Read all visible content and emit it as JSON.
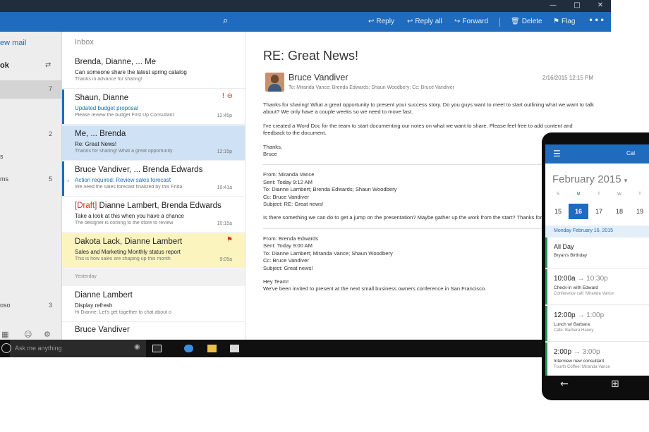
{
  "window": {
    "title_buttons": [
      "—",
      "□",
      "✕"
    ]
  },
  "toolbar": {
    "actions": [
      {
        "icon": "reply-icon",
        "glyph": "↩",
        "label": "Reply"
      },
      {
        "icon": "reply-all-icon",
        "glyph": "↩",
        "label": "Reply all"
      },
      {
        "icon": "forward-icon",
        "glyph": "↪",
        "label": "Forward"
      },
      {
        "icon": "delete-icon",
        "glyph": "🗑",
        "label": "Delete"
      },
      {
        "icon": "flag-icon",
        "glyph": "⚑",
        "label": "Flag"
      }
    ],
    "more": "•••",
    "accent": "#1f6bbd"
  },
  "nav": {
    "new_mail": "ew mail",
    "account": "ok",
    "rows": [
      {
        "label": "",
        "count": "7"
      },
      {
        "label": "",
        "count": ""
      },
      {
        "label": "",
        "count": "2"
      },
      {
        "label": "s",
        "count": ""
      },
      {
        "label": "ms",
        "count": "5"
      }
    ],
    "folder_bottom": {
      "label": "oso",
      "count": "3"
    }
  },
  "list": {
    "header": "Inbox",
    "messages": [
      {
        "from": "Brenda, Dianne, ... Me",
        "subject": "Can someone share the latest spring catalog",
        "preview": "Thanks in advance for sharing!",
        "time": ""
      },
      {
        "from": "Shaun, Dianne",
        "subject": "Updated budget proposal",
        "preview": "Please review the budget First Up Consultant",
        "time": "12:45p"
      },
      {
        "from": "Me, ... Brenda",
        "subject": "Re: Great News!",
        "preview": "Thanks for sharing! What a great opportunity",
        "time": "12:15p"
      },
      {
        "from": "Bruce Vandiver, ... Brenda Edwards",
        "subject": "Action required: Review sales forecast",
        "preview": "We need the sales forecast finalized by this Frida",
        "time": "10:41a"
      },
      {
        "draft": "[Draft]",
        "from": "Dianne Lambert, Brenda Edwards",
        "subject": "Take a look at this when you have a chance",
        "preview": "The designer is coming to the store to review",
        "time": "10:15a"
      },
      {
        "from": "Dakota Lack, Dianne Lambert",
        "subject": "Sales and Marketing Monthly status report",
        "preview": "This is how sales are shaping up this month",
        "time": "9:05a"
      }
    ],
    "divider": "Yesterday",
    "older": [
      {
        "from": "Dianne Lambert",
        "subject": "Display refresh",
        "preview": "Hi Dianne. Let's get together to chat about o",
        "time": ""
      },
      {
        "from": "Bruce Vandiver",
        "subject": "",
        "preview": "",
        "time": ""
      }
    ]
  },
  "reading": {
    "subject": "RE: Great News!",
    "sender": "Bruce Vandiver",
    "to": "To: Miranda Vance; Brenda Edwards; Shaun Woodbery;  Cc: Bruce Vandiver",
    "date": "2/16/2015  12:15 PM",
    "body": [
      "Thanks for sharing! What a great opportunity to present your success story. Do you guys want to meet to start outlining what we want to talk about? We only have a couple weeks so we need to move fast.",
      "I've created a Word Doc for the team to start documenting our notes on what we want to share. Please feel free to add content and feedback to the document.",
      "Thanks,",
      "Bruce"
    ],
    "quote1": {
      "header": [
        "From: Miranda Vance",
        "Sent: Today 9:12 AM",
        "To: Dianne Lambert; Brenda Edwards; Shaun Woodbery",
        "Cc: Bruce Vandiver",
        "Subject: RE: Great news!"
      ],
      "text": "Is there something we can do to get a jump on the presentation? Maybe gather up the work from the start? Thanks for sharing Brenda."
    },
    "quote2": {
      "header": [
        "From: Brenda Edwards",
        "Sent: Today 9:00 AM",
        "To: Dianne Lambert; Miranda Vance; Shaun Woodbery",
        "Cc: Bruce Vandiver",
        "Subject: Great news!"
      ],
      "greeting": "Hey Team!",
      "text": "We've been invited to present at the next small business owners conference in San Francisco."
    }
  },
  "taskbar": {
    "search_placeholder": "Ask me anything",
    "icons": [
      "task-view-icon",
      "edge-icon",
      "file-explorer-icon",
      "store-icon"
    ]
  },
  "phone": {
    "top_tab": "Cal",
    "month": "February 2015",
    "week_days": [
      "S",
      "M",
      "T",
      "W",
      "T"
    ],
    "week_dates": [
      "15",
      "16",
      "17",
      "18",
      "19"
    ],
    "selected_date": "16",
    "day_header": "Monday February 16, 2015",
    "all_day": {
      "label": "All Day",
      "title": "Bryan's Birthday"
    },
    "events": [
      {
        "start": "10:00a",
        "end": "→ 10:30p",
        "title": "Check-in with Edward",
        "location": "Conference call: Miranda Vance"
      },
      {
        "start": "12:00p",
        "end": "→ 1:00p",
        "title": "Lunch w/ Barbara",
        "location": "Cafe: Barbara Haney"
      },
      {
        "start": "2:00p",
        "end": "→ 3:00p",
        "title": "Interview new consultant",
        "location": "Fourth Coffee: Miranda Vance"
      }
    ],
    "event_color": "#1e9e5a"
  }
}
